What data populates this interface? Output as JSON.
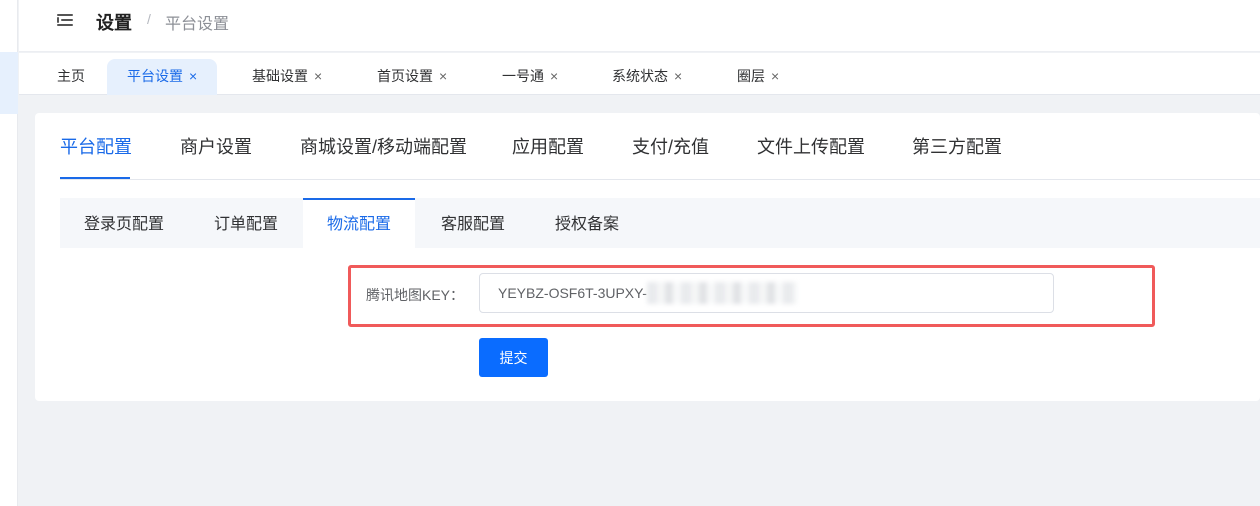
{
  "header": {
    "breadcrumb_root": "设置",
    "breadcrumb_separator": "/",
    "breadcrumb_current": "平台设置"
  },
  "tabs": [
    {
      "label": "主页",
      "closable": false
    },
    {
      "label": "平台设置",
      "closable": true,
      "active": true
    },
    {
      "label": "基础设置",
      "closable": true
    },
    {
      "label": "首页设置",
      "closable": true
    },
    {
      "label": "一号通",
      "closable": true
    },
    {
      "label": "系统状态",
      "closable": true
    },
    {
      "label": "圈层",
      "closable": true
    }
  ],
  "close_glyph": "×",
  "main_tabs": [
    "平台配置",
    "商户设置",
    "商城设置/移动端配置",
    "应用配置",
    "支付/充值",
    "文件上传配置",
    "第三方配置"
  ],
  "sub_tabs": [
    "登录页配置",
    "订单配置",
    "物流配置",
    "客服配置",
    "授权备案"
  ],
  "form": {
    "label": "腾讯地图KEY：",
    "value_visible": "YEYBZ-OSF6T-3UPXY-",
    "submit_label": "提交"
  },
  "colors": {
    "accent": "#1a6ae8",
    "highlight_border": "#f05a5a",
    "button": "#0a6cff"
  },
  "icons": {
    "menu": "hamburger-menu-icon",
    "tab_close": "close-icon",
    "redaction": "blurred-redaction"
  }
}
